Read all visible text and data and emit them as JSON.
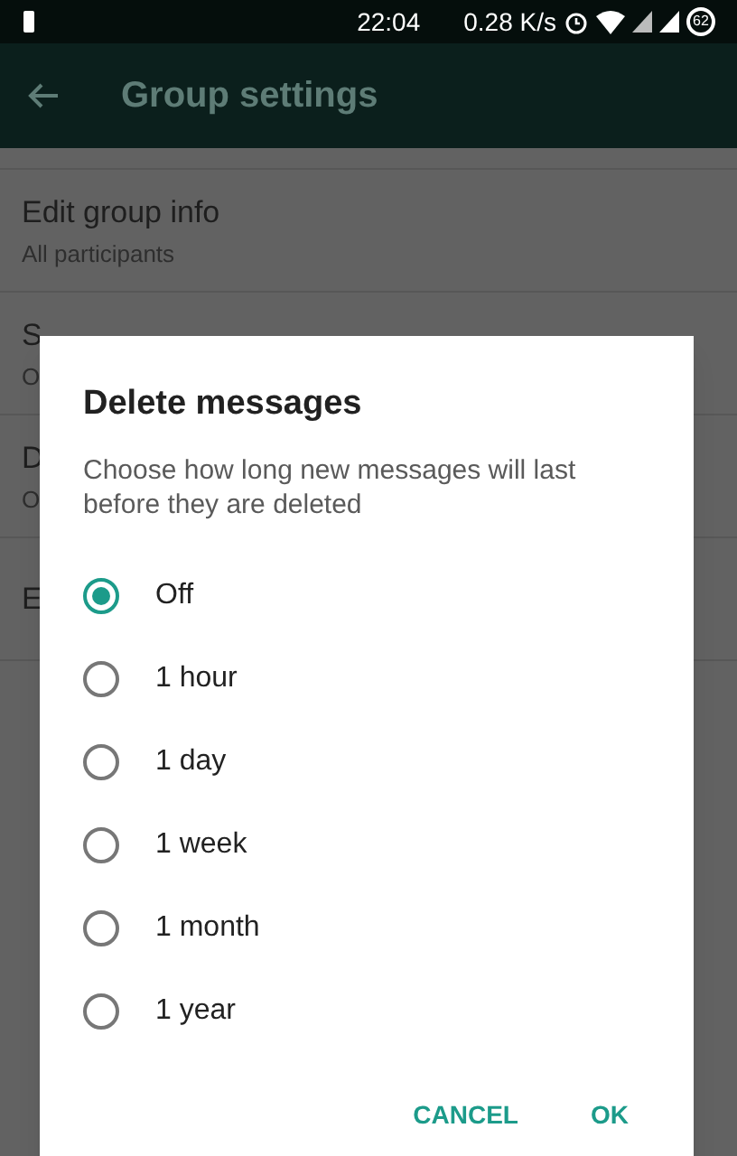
{
  "status_bar": {
    "time": "22:04",
    "speed": "0.28 K/s",
    "battery": "62"
  },
  "app_bar": {
    "title": "Group settings"
  },
  "settings": [
    {
      "title": "Edit group info",
      "subtitle": "All participants"
    },
    {
      "title": "S",
      "subtitle": "O"
    },
    {
      "title": "D",
      "subtitle": "O"
    },
    {
      "title": "E"
    }
  ],
  "dialog": {
    "title": "Delete messages",
    "description": "Choose how long new messages will last before they are deleted",
    "options": [
      {
        "label": "Off",
        "selected": true
      },
      {
        "label": "1 hour",
        "selected": false
      },
      {
        "label": "1 day",
        "selected": false
      },
      {
        "label": "1 week",
        "selected": false
      },
      {
        "label": "1 month",
        "selected": false
      },
      {
        "label": "1 year",
        "selected": false
      }
    ],
    "buttons": [
      "CANCEL",
      "OK"
    ]
  }
}
